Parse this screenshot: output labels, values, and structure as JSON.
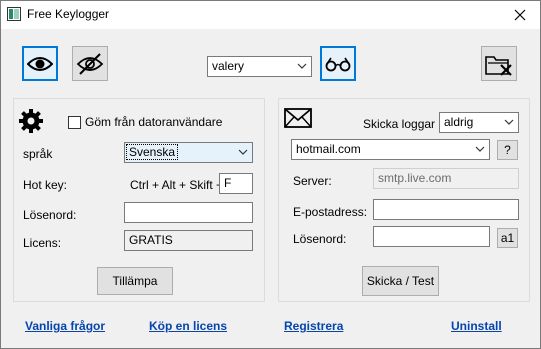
{
  "window": {
    "title": "Free Keylogger"
  },
  "toolbar": {
    "user_value": "valery"
  },
  "left": {
    "hide_label": "Göm från datoranvändare",
    "language_label": "språk",
    "language_value": "Svenska",
    "hotkey_label": "Hot key:",
    "hotkey_combo": "Ctrl + Alt + Skift +",
    "hotkey_value": "F",
    "password_label": "Lösenord:",
    "password_value": "",
    "license_label": "Licens:",
    "license_value": "GRATIS",
    "apply_label": "Tillämpa"
  },
  "right": {
    "send_logs_label": "Skicka loggar",
    "send_logs_value": "aldrig",
    "provider_value": "hotmail.com",
    "help_label": "?",
    "server_label": "Server:",
    "server_value": "smtp.live.com",
    "email_label": "E-postadress:",
    "email_value": "",
    "password_label": "Lösenord:",
    "password_value": "",
    "a1_label": "a1",
    "send_test_label": "Skicka / Test"
  },
  "footer": {
    "faq": "Vanliga frågor",
    "buy": "Köp en licens",
    "register": "Registrera",
    "uninstall": "Uninstall"
  },
  "colors": {
    "accent": "#0078d7",
    "link": "#0645ad"
  }
}
